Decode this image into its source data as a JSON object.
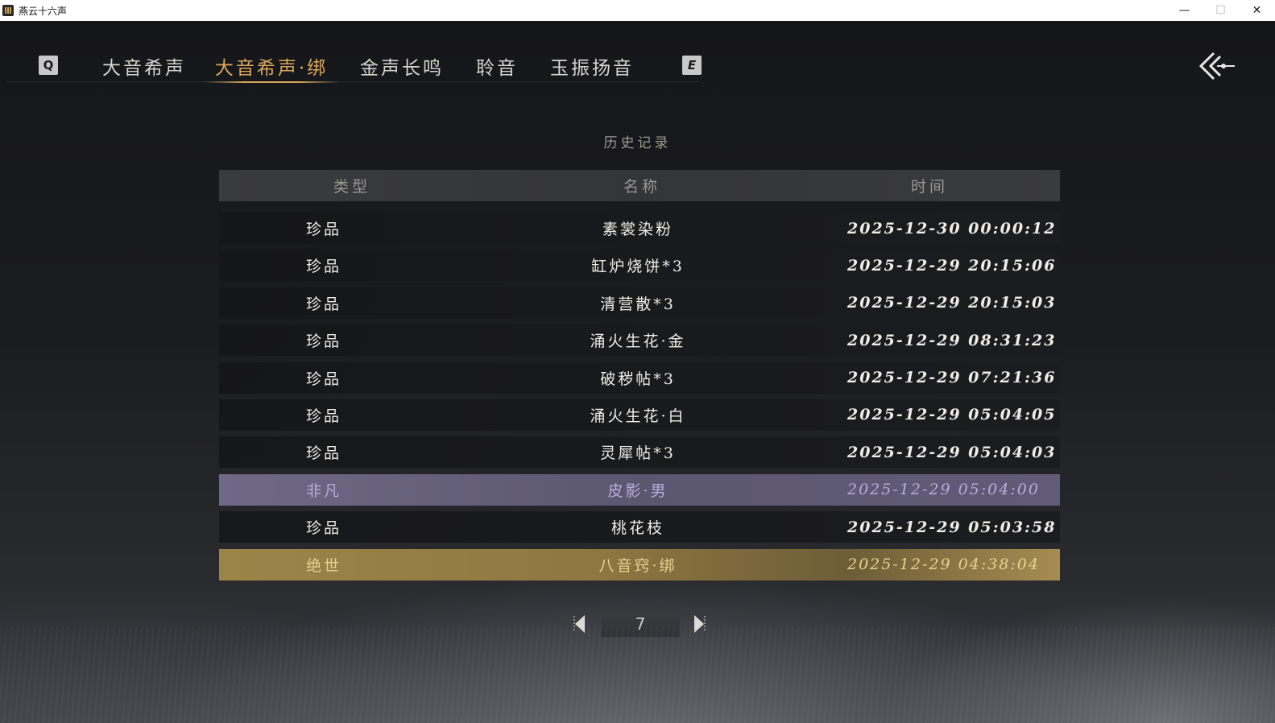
{
  "window": {
    "title": "燕云十六声",
    "minimize_glyph": "—",
    "maximize_glyph": "☐",
    "close_glyph": "✕"
  },
  "tabs": {
    "prev_key": "Q",
    "next_key": "E",
    "items": [
      {
        "label": "大音希声",
        "active": false
      },
      {
        "label": "大音希声·绑",
        "active": true
      },
      {
        "label": "金声长鸣",
        "active": false
      },
      {
        "label": "聆音",
        "active": false
      },
      {
        "label": "玉振扬音",
        "active": false
      }
    ],
    "active_color": "#d9a75c"
  },
  "history": {
    "title": "历史记录",
    "columns": {
      "type": "类型",
      "name": "名称",
      "time": "时间"
    },
    "rows": [
      {
        "type": "珍品",
        "name": "素裳染粉",
        "time": "2025-12-30 00:00:12",
        "rarity": "normal"
      },
      {
        "type": "珍品",
        "name": "缸炉烧饼*3",
        "time": "2025-12-29 20:15:06",
        "rarity": "normal"
      },
      {
        "type": "珍品",
        "name": "清营散*3",
        "time": "2025-12-29 20:15:03",
        "rarity": "normal"
      },
      {
        "type": "珍品",
        "name": "涌火生花·金",
        "time": "2025-12-29 08:31:23",
        "rarity": "normal"
      },
      {
        "type": "珍品",
        "name": "破秽帖*3",
        "time": "2025-12-29 07:21:36",
        "rarity": "normal"
      },
      {
        "type": "珍品",
        "name": "涌火生花·白",
        "time": "2025-12-29 05:04:05",
        "rarity": "normal"
      },
      {
        "type": "珍品",
        "name": "灵犀帖*3",
        "time": "2025-12-29 05:04:03",
        "rarity": "normal"
      },
      {
        "type": "非凡",
        "name": "皮影·男",
        "time": "2025-12-29 05:04:00",
        "rarity": "rare"
      },
      {
        "type": "珍品",
        "name": "桃花枝",
        "time": "2025-12-29 05:03:58",
        "rarity": "normal"
      },
      {
        "type": "绝世",
        "name": "八音窍·绑",
        "time": "2025-12-29 04:38:04",
        "rarity": "legend"
      }
    ],
    "rarity_colors": {
      "rare": "#6f6985",
      "legend": "#9c8449"
    }
  },
  "pager": {
    "page": "7"
  }
}
